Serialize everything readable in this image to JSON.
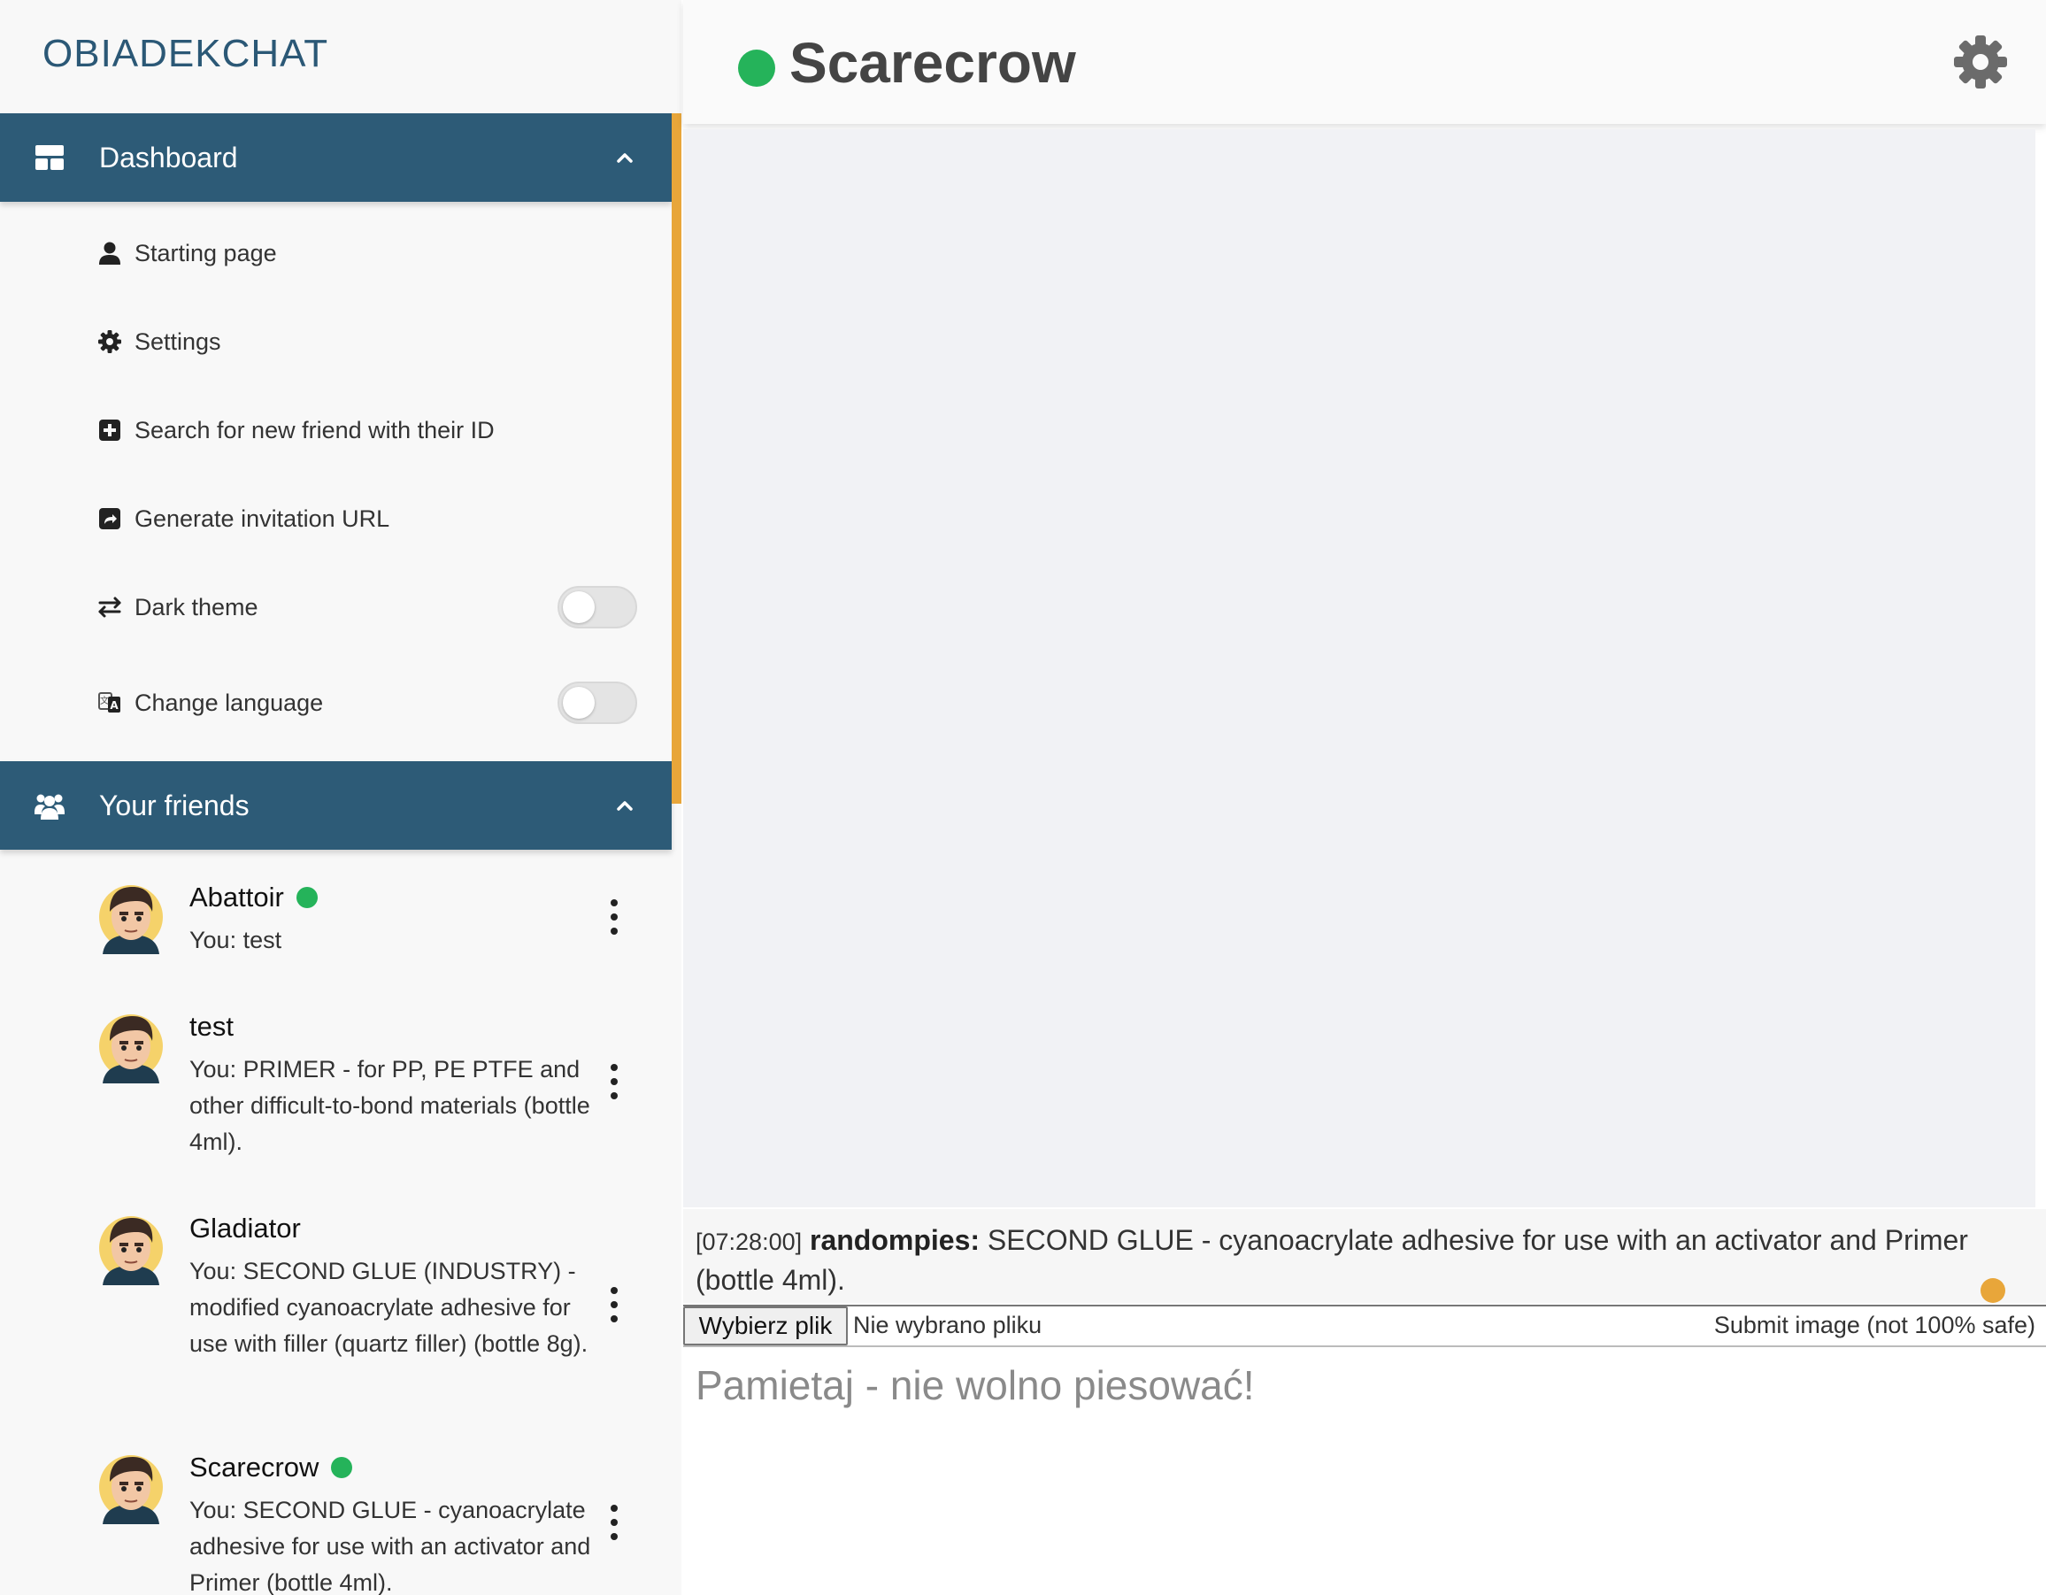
{
  "app": {
    "brand": "OBIADEKCHAT"
  },
  "sidebar": {
    "dashboard": {
      "title": "Dashboard",
      "items": [
        {
          "label": "Starting page",
          "icon": "user-icon"
        },
        {
          "label": "Settings",
          "icon": "gear-icon"
        },
        {
          "label": "Search for new friend with their ID",
          "icon": "plus-square-icon"
        },
        {
          "label": "Generate invitation URL",
          "icon": "share-icon"
        },
        {
          "label": "Dark theme",
          "icon": "swap-arrows-icon",
          "toggle": false
        },
        {
          "label": "Change language",
          "icon": "language-icon",
          "toggle": false
        }
      ]
    },
    "friends": {
      "title": "Your friends",
      "list": [
        {
          "name": "Abattoir",
          "online": true,
          "last_message": "You: test"
        },
        {
          "name": "test",
          "online": false,
          "last_message": "You: PRIMER - for PP, PE PTFE and other difficult-to-bond materials (bottle 4ml)."
        },
        {
          "name": "Gladiator",
          "online": false,
          "last_message": "You: SECOND GLUE (INDUSTRY) - modified cyanoacrylate adhesive for use with filler (quartz filler) (bottle 8g)."
        },
        {
          "name": "Scarecrow",
          "online": true,
          "last_message": "You: SECOND GLUE - cyanoacrylate adhesive for use with an activator and Primer (bottle 4ml)."
        }
      ]
    }
  },
  "chat": {
    "title": "Scarecrow",
    "online": true,
    "messages": [
      {
        "time": "[07:28:00]",
        "author": "randompies:",
        "text": "SECOND GLUE - cyanoacrylate adhesive for use with an activator and Primer (bottle 4ml)."
      }
    ],
    "upload": {
      "choose_label": "Wybierz plik",
      "file_status": "Nie wybrano pliku",
      "submit_label": "Submit image (not 100% safe)"
    },
    "composer": {
      "placeholder": "Pamietaj - nie wolno piesować!"
    }
  },
  "colors": {
    "brand": "#2b5876",
    "header_bg": "#2d5b77",
    "accent": "#e8a63a",
    "online": "#25b35a"
  }
}
